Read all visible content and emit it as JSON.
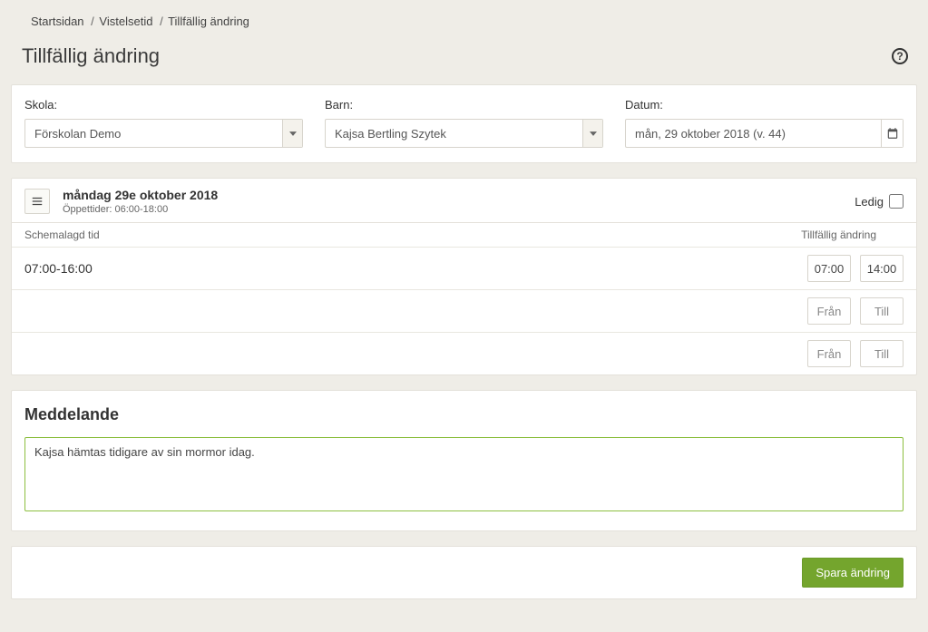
{
  "breadcrumb": {
    "home": "Startsidan",
    "level1": "Vistelsetid",
    "level2": "Tillfällig ändring"
  },
  "page_title": "Tillfällig ändring",
  "filters": {
    "school": {
      "label": "Skola:",
      "value": "Förskolan Demo"
    },
    "child": {
      "label": "Barn:",
      "value": "Kajsa Bertling Szytek"
    },
    "date": {
      "label": "Datum:",
      "value": "mån, 29 oktober 2018 (v. 44)"
    }
  },
  "day": {
    "title": "måndag 29e oktober 2018",
    "open_hours_label": "Öppettider: 06:00-18:00",
    "ledig_label": "Ledig",
    "ledig_checked": false,
    "col_scheduled": "Schemalagd tid",
    "col_temp": "Tillfällig ändring",
    "rows": [
      {
        "scheduled": "07:00-16:00",
        "from": "07:00",
        "to": "14:00"
      },
      {
        "scheduled": "",
        "from_ph": "Från",
        "to_ph": "Till"
      },
      {
        "scheduled": "",
        "from_ph": "Från",
        "to_ph": "Till"
      }
    ]
  },
  "message": {
    "title": "Meddelande",
    "value": "Kajsa hämtas tidigare av sin mormor idag."
  },
  "actions": {
    "save": "Spara ändring"
  }
}
